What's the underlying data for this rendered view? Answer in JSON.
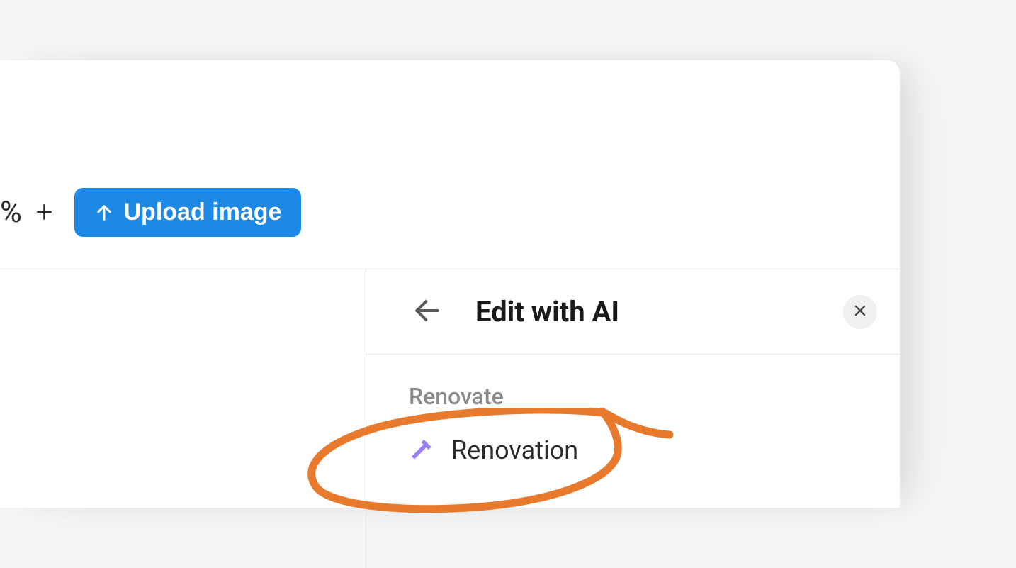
{
  "toolbar": {
    "percent_label": "%",
    "plus_label": "+",
    "upload_button_label": "Upload image"
  },
  "panel": {
    "title": "Edit with AI",
    "section_label": "Renovate",
    "menu_items": [
      {
        "icon": "hammer",
        "label": "Renovation"
      }
    ]
  },
  "colors": {
    "accent_blue": "#1e88e5",
    "accent_purple": "#9b7ef7",
    "annotation_orange": "#e87a2e"
  }
}
